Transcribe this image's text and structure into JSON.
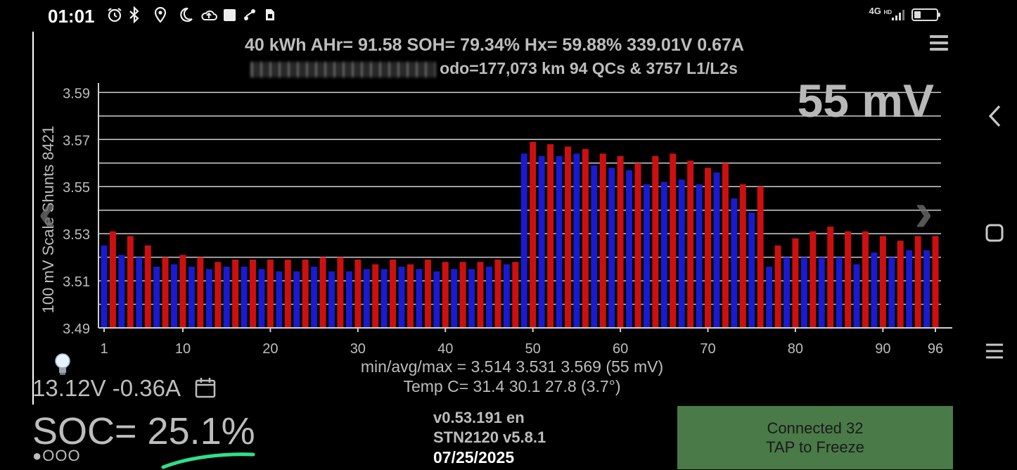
{
  "status_bar": {
    "time": "01:01",
    "icons": [
      "alarm-icon",
      "bluetooth-icon",
      "location-icon",
      "do-not-disturb-moon-icon",
      "cloud-upload-icon",
      "square-notification-icon",
      "sync-icon",
      "sim-icon"
    ],
    "network": "4G",
    "network_hd": "HD"
  },
  "header": {
    "line1": "40 kWh  AHr= 91.58  SOH= 79.34%   Hx= 59.88%   339.01V 0.67A",
    "line2_suffix": "odo=177,073 km  94 QCs & 3757 L1/L2s"
  },
  "overlay": {
    "delta_mv": "55 mV"
  },
  "chart_data": {
    "type": "bar",
    "ylabel": "100 mV Scale  Shunts 8421",
    "ylim": [
      3.49,
      3.594
    ],
    "yticks": [
      "3.59",
      "3.57",
      "3.55",
      "3.53",
      "3.51",
      "3.49"
    ],
    "xticks": [
      "1",
      "10",
      "20",
      "30",
      "40",
      "50",
      "60",
      "70",
      "80",
      "90",
      "96"
    ],
    "colors": {
      "odd": "#1a1ad0",
      "even": "#cc1010",
      "grid": "#cfcfcf",
      "axis": "#d0d0d0"
    },
    "series": [
      {
        "values": [
          3.525,
          3.531,
          3.521,
          3.529,
          3.52,
          3.525,
          3.516,
          3.52,
          3.517,
          3.521,
          3.516,
          3.52,
          3.515,
          3.518,
          3.516,
          3.519,
          3.516,
          3.519,
          3.515,
          3.519,
          3.514,
          3.519,
          3.514,
          3.519,
          3.516,
          3.52,
          3.514,
          3.52,
          3.514,
          3.519,
          3.515,
          3.517,
          3.515,
          3.519,
          3.516,
          3.517,
          3.515,
          3.519,
          3.514,
          3.518,
          3.515,
          3.518,
          3.515,
          3.518,
          3.516,
          3.519,
          3.517,
          3.518,
          3.564,
          3.569,
          3.563,
          3.568,
          3.563,
          3.567,
          3.564,
          3.566,
          3.559,
          3.564,
          3.558,
          3.563,
          3.557,
          3.56,
          3.551,
          3.563,
          3.552,
          3.564,
          3.553,
          3.561,
          3.551,
          3.558,
          3.556,
          3.56,
          3.545,
          3.551,
          3.539,
          3.55,
          3.516,
          3.525,
          3.52,
          3.528,
          3.52,
          3.531,
          3.52,
          3.533,
          3.52,
          3.531,
          3.517,
          3.531,
          3.522,
          3.529,
          3.52,
          3.527,
          3.523,
          3.529,
          3.523,
          3.529
        ]
      }
    ]
  },
  "stats": {
    "line1": "min/avg/max = 3.514 3.531 3.569  (55 mV)",
    "line2": "Temp C= 31.4  30.1  27.8  (3.7°)"
  },
  "aux": {
    "voltage_current": "13.12V -0.36A"
  },
  "soc": {
    "label": "SOC= 25.1%",
    "dots": "●OOO"
  },
  "version": {
    "app": "v0.53.191 en",
    "adapter": "STN2120 v5.8.1",
    "date": "07/25/2025"
  },
  "connect_panel": {
    "line1": "Connected 32",
    "line2": "TAP to Freeze",
    "color": "#4a7a48"
  },
  "nav": {
    "back": "chevron-left-icon",
    "home": "square-home-icon",
    "recents": "menu-lines-icon"
  }
}
